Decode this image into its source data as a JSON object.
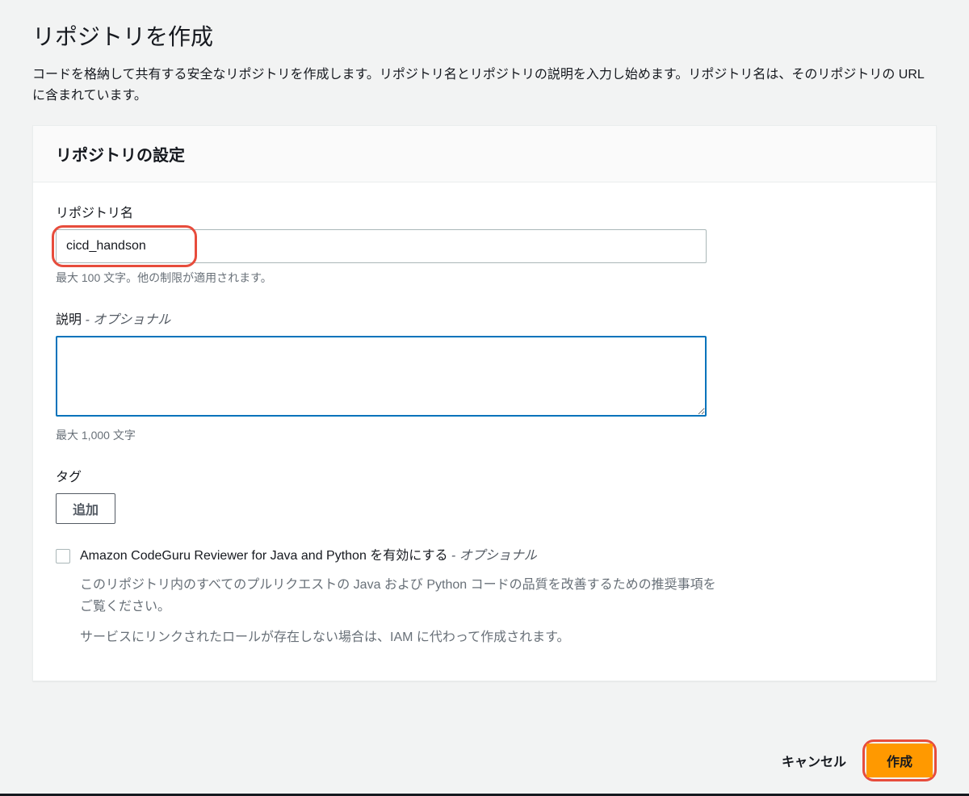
{
  "header": {
    "title": "リポジトリを作成",
    "description": "コードを格納して共有する安全なリポジトリを作成します。リポジトリ名とリポジトリの説明を入力し始めます。リポジトリ名は、そのリポジトリの URL に含まれています。"
  },
  "panel": {
    "title": "リポジトリの設定"
  },
  "form": {
    "repoName": {
      "label": "リポジトリ名",
      "value": "cicd_handson",
      "help": "最大 100 文字。他の制限が適用されます。"
    },
    "description": {
      "label": "説明",
      "optionalSuffix": " - オプショナル",
      "value": "",
      "help": "最大 1,000 文字"
    },
    "tags": {
      "label": "タグ",
      "addButton": "追加"
    },
    "codeguru": {
      "label": "Amazon CodeGuru Reviewer for Java and Python を有効にする",
      "optionalSuffix": " - オプショナル",
      "desc1": "このリポジトリ内のすべてのプルリクエストの Java および Python コードの品質を改善するための推奨事項をご覧ください。",
      "desc2": "サービスにリンクされたロールが存在しない場合は、IAM に代わって作成されます。"
    }
  },
  "footer": {
    "cancel": "キャンセル",
    "create": "作成"
  },
  "colors": {
    "accent": "#ff9900",
    "focus": "#0073bb",
    "callout": "#e74c3c"
  }
}
